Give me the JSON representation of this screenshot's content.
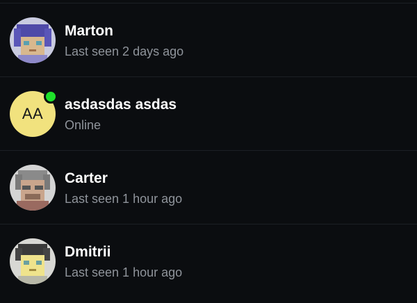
{
  "contacts": [
    {
      "name": "Marton",
      "status": "Last seen 2 days ago",
      "avatar_icon": "pixel-avatar-purple-icon",
      "online": false
    },
    {
      "name": "asdasdas asdas",
      "status": "Online",
      "initials": "AA",
      "avatar_color": "#f1e27e",
      "online": true,
      "online_color": "#1ee12a"
    },
    {
      "name": "Carter",
      "status": "Last seen 1 hour ago",
      "avatar_icon": "pixel-avatar-gray-icon",
      "online": false
    },
    {
      "name": "Dmitrii",
      "status": "Last seen 1 hour ago",
      "avatar_icon": "pixel-avatar-yellow-icon",
      "online": false
    }
  ]
}
